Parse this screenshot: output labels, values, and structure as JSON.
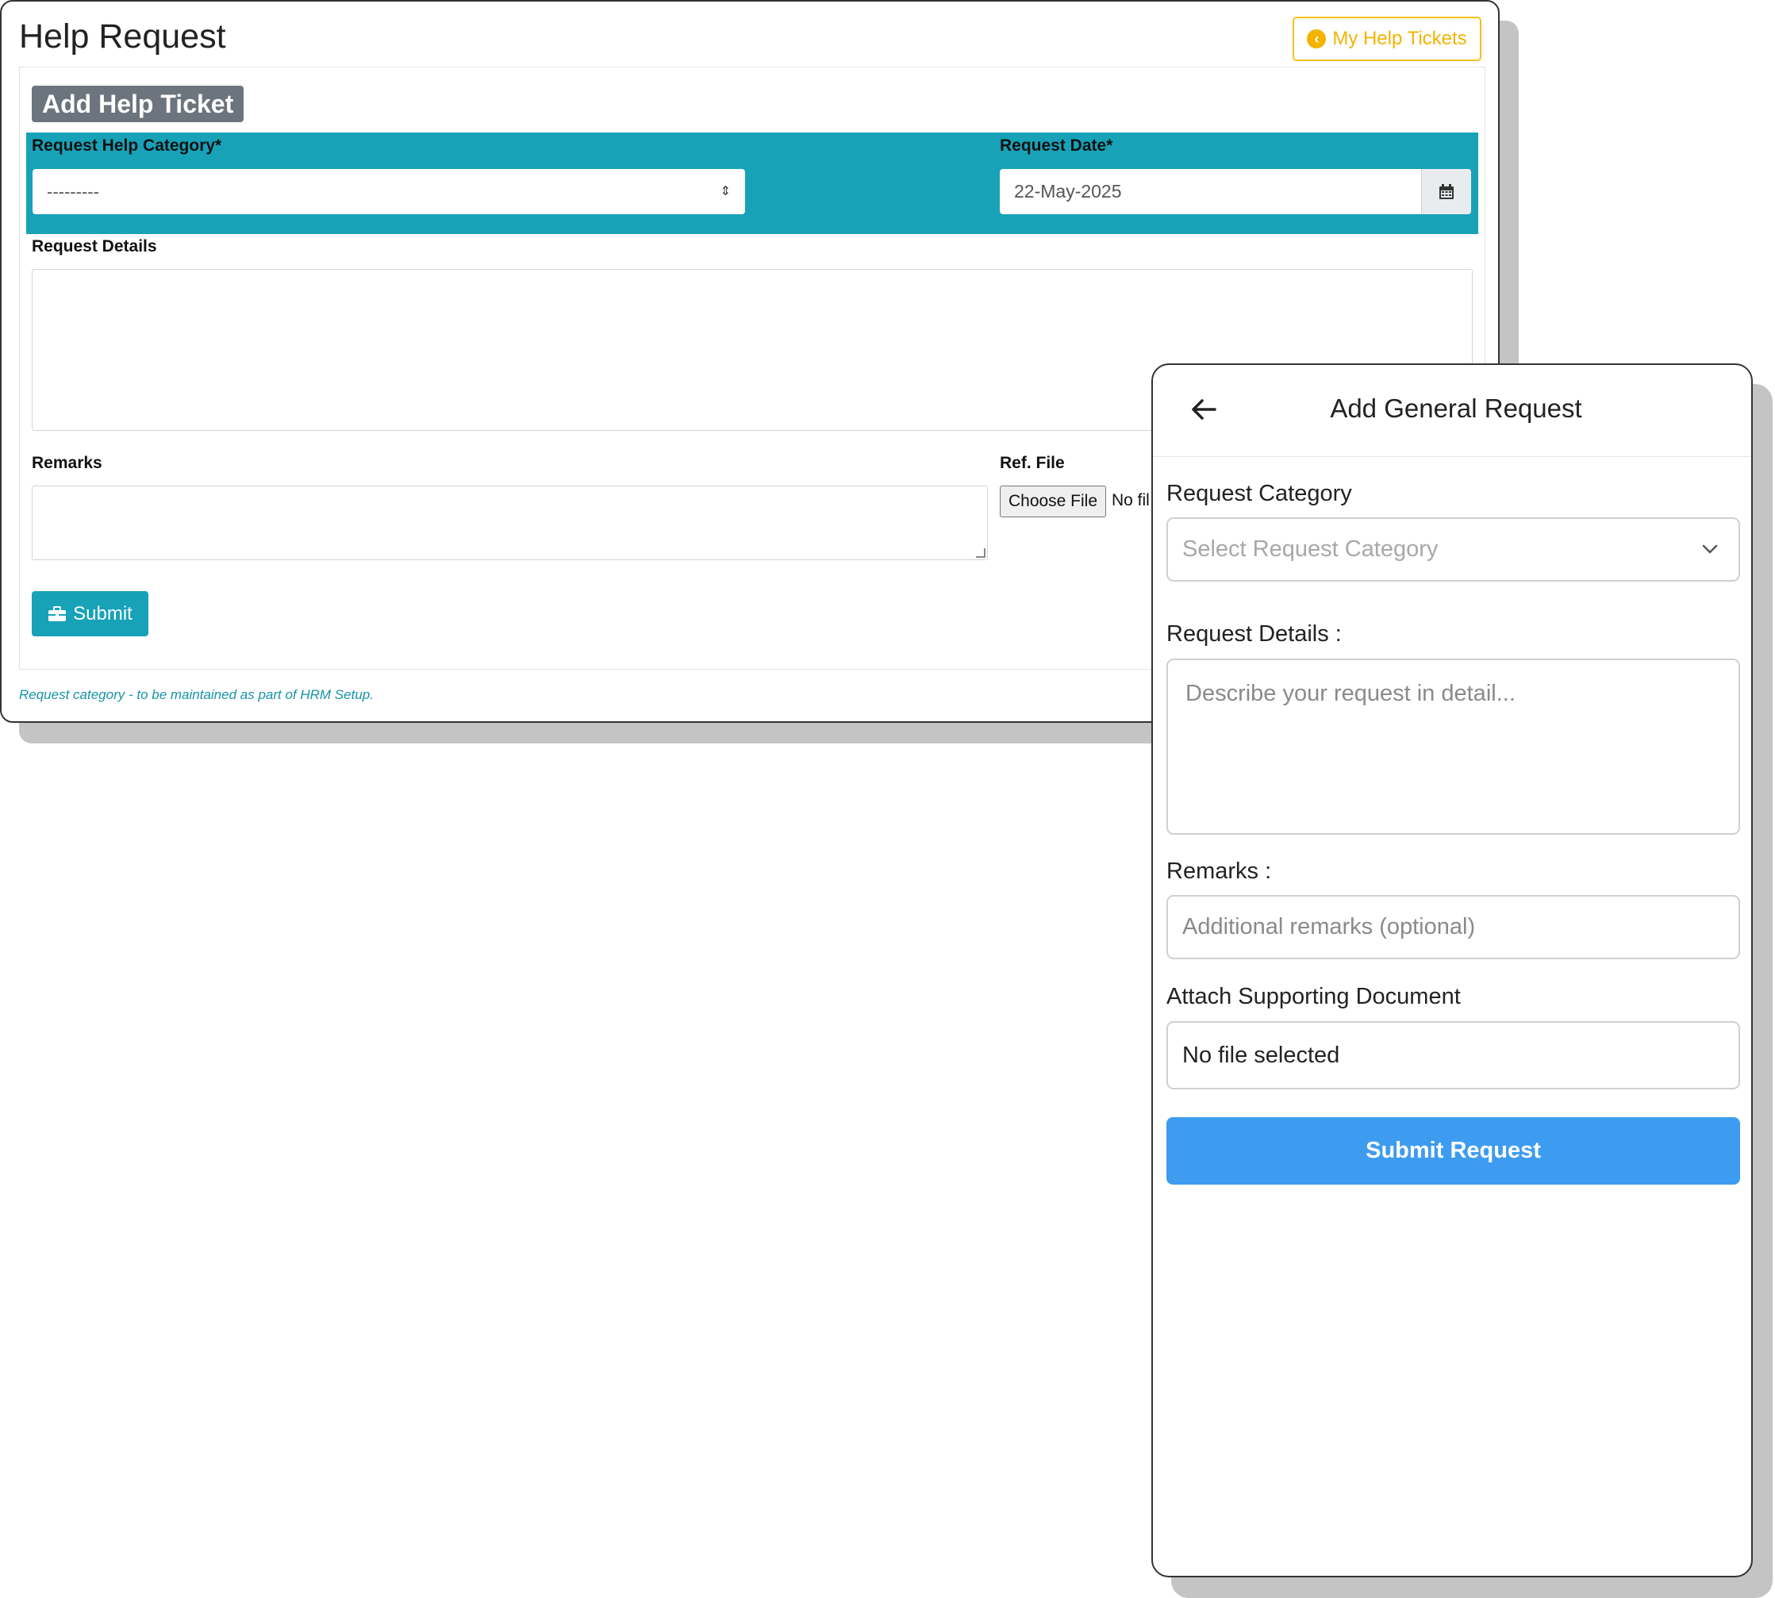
{
  "desktop": {
    "title": "Help Request",
    "tickets_button": "My Help Tickets",
    "form_badge": "Add Help Ticket",
    "category_label": "Request Help Category*",
    "category_value": "---------",
    "date_label": "Request Date*",
    "date_value": "22-May-2025",
    "details_label": "Request Details",
    "remarks_label": "Remarks",
    "ref_file_label": "Ref. File",
    "choose_file": "Choose File",
    "no_file": "No fil",
    "submit": "Submit",
    "footnote": "Request category - to be maintained as part of HRM Setup."
  },
  "mobile": {
    "title": "Add General Request",
    "category_label": "Request Category",
    "category_placeholder": "Select Request Category",
    "details_label": "Request Details :",
    "details_placeholder": "Describe your request in detail...",
    "remarks_label": "Remarks :",
    "remarks_placeholder": "Additional remarks (optional)",
    "attach_label": "Attach Supporting Document",
    "attach_value": "No file selected",
    "submit": "Submit Request"
  },
  "colors": {
    "teal": "#17a2b8",
    "warning": "#f2b400",
    "badge_gray": "#6c757d",
    "mobile_submit": "#3d9cf0"
  },
  "icons": [
    "circle-arrow-left-icon",
    "sort-icon",
    "calendar-icon",
    "briefcase-icon",
    "back-arrow-icon",
    "chevron-down-icon"
  ]
}
